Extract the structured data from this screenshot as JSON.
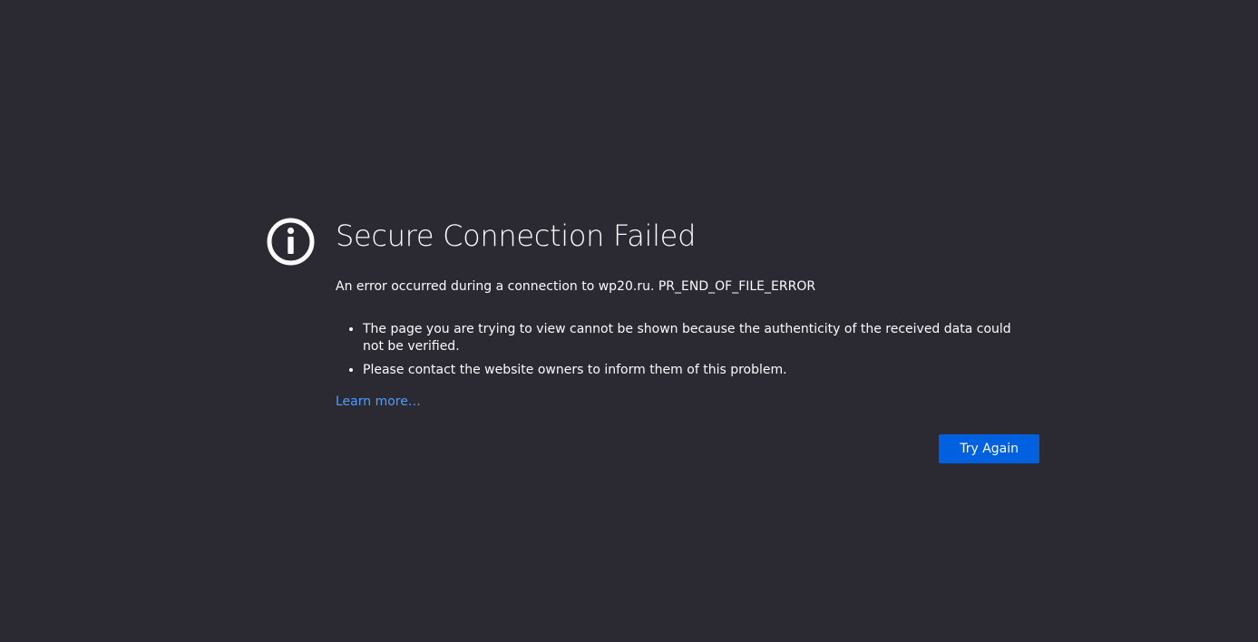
{
  "page": {
    "title": "Secure Connection Failed",
    "description": "An error occurred during a connection to wp20.ru. PR_END_OF_FILE_ERROR",
    "details": [
      "The page you are trying to view cannot be shown because the authenticity of the received data could not be verified.",
      "Please contact the website owners to inform them of this problem."
    ],
    "learn_more_label": "Learn more…",
    "try_again_label": "Try Again"
  },
  "colors": {
    "background": "#2b2a33",
    "text": "#fbfbfe",
    "link": "#4f9cf9",
    "button": "#0061e0"
  },
  "icons": {
    "main": "info-icon"
  }
}
